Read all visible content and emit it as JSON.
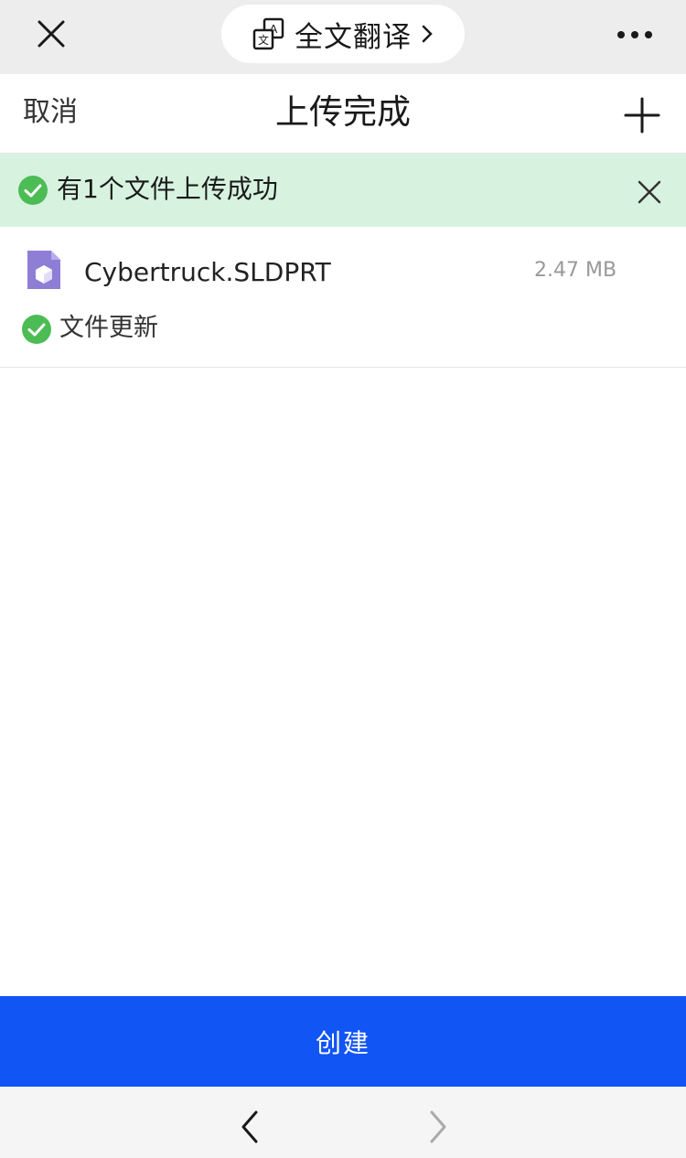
{
  "topbar": {
    "translate_label": "全文翻译",
    "close_icon": "close-icon",
    "translate_icon": "translate-icon",
    "more_icon": "more-dots-icon"
  },
  "header": {
    "cancel_label": "取消",
    "title": "上传完成",
    "add_icon": "plus-icon"
  },
  "banner": {
    "message": "有1个文件上传成功",
    "color": "#d7f3e0",
    "check_icon": "check-circle-icon",
    "close_icon": "close-icon"
  },
  "files": [
    {
      "name": "Cybertruck.SLDPRT",
      "size": "2.47 MB",
      "status": "文件更新",
      "icon": "cube-file-icon"
    }
  ],
  "actions": {
    "create_label": "创建",
    "create_color": "#1255f5"
  },
  "bottom_nav": {
    "back_icon": "chevron-left-icon",
    "forward_icon": "chevron-right-icon"
  }
}
